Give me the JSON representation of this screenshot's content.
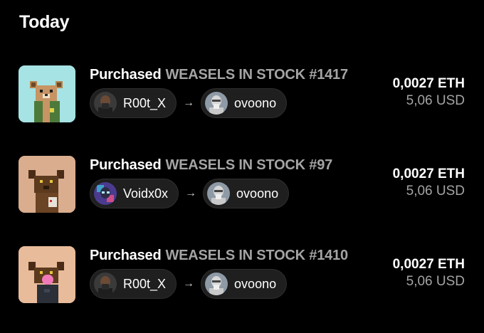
{
  "section": {
    "title": "Today"
  },
  "activity": [
    {
      "action": "Purchased",
      "item": "WEASELS IN STOCK #1417",
      "from": "R00t_X",
      "to": "ovoono",
      "price_eth": "0,0027 ETH",
      "price_usd": "5,06 USD",
      "thumb_bg": "#a6e3e4"
    },
    {
      "action": "Purchased",
      "item": "WEASELS IN STOCK #97",
      "from": "Voidx0x",
      "to": "ovoono",
      "price_eth": "0,0027 ETH",
      "price_usd": "5,06 USD",
      "thumb_bg": "#d9ad8e"
    },
    {
      "action": "Purchased",
      "item": "WEASELS IN STOCK #1410",
      "from": "R00t_X",
      "to": "ovoono",
      "price_eth": "0,0027 ETH",
      "price_usd": "5,06 USD",
      "thumb_bg": "#e8bb9b"
    }
  ],
  "icons": {
    "arrow": "→"
  }
}
